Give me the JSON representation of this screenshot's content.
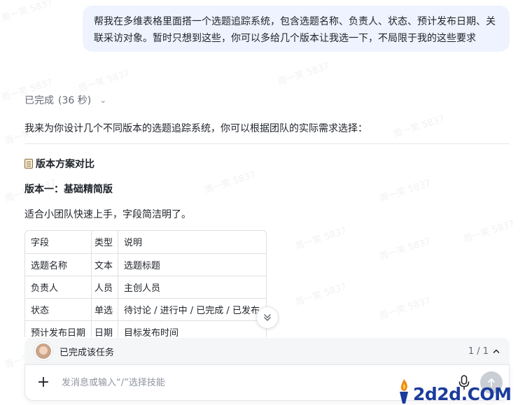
{
  "conversation": {
    "user_message": "帮我在多维表格里面搭一个选题追踪系统，包含选题名称、负责人、状态、预计发布日期、关联采访对象。暂时只想到这些，你可以多给几个版本让我选一下，不局限于我的这些要求",
    "status": {
      "label": "已完成",
      "duration": "(36 秒)"
    },
    "intro": "我来为你设计几个不同版本的选题追踪系统，你可以根据团队的实际需求选择：",
    "section_title": "版本方案对比",
    "section_icon": "clipboard-icon",
    "version1": {
      "title": "版本一：基础精简版",
      "description": "适合小团队快速上手，字段简洁明了。",
      "table": [
        [
          "字段",
          "类型",
          "说明"
        ],
        [
          "选题名称",
          "文本",
          "选题标题"
        ],
        [
          "负责人",
          "人员",
          "主创人员"
        ],
        [
          "状态",
          "单选",
          "待讨论 / 进行中 / 已完成 / 已发布"
        ],
        [
          "预计发布日期",
          "日期",
          "目标发布时间"
        ]
      ]
    }
  },
  "task_bar": {
    "label": "已完成该任务",
    "pager": "1 / 1"
  },
  "input": {
    "placeholder": "发消息或输入“/”选择技能"
  },
  "watermark": {
    "text": "周一笑 5837"
  },
  "logo": {
    "text": "2d2d.COM"
  },
  "colors": {
    "user_bubble": "#eef3ff",
    "task_bar": "#f5f6f7",
    "send_button": "#c9cdd4",
    "logo_blue": "#1b3c9c"
  }
}
